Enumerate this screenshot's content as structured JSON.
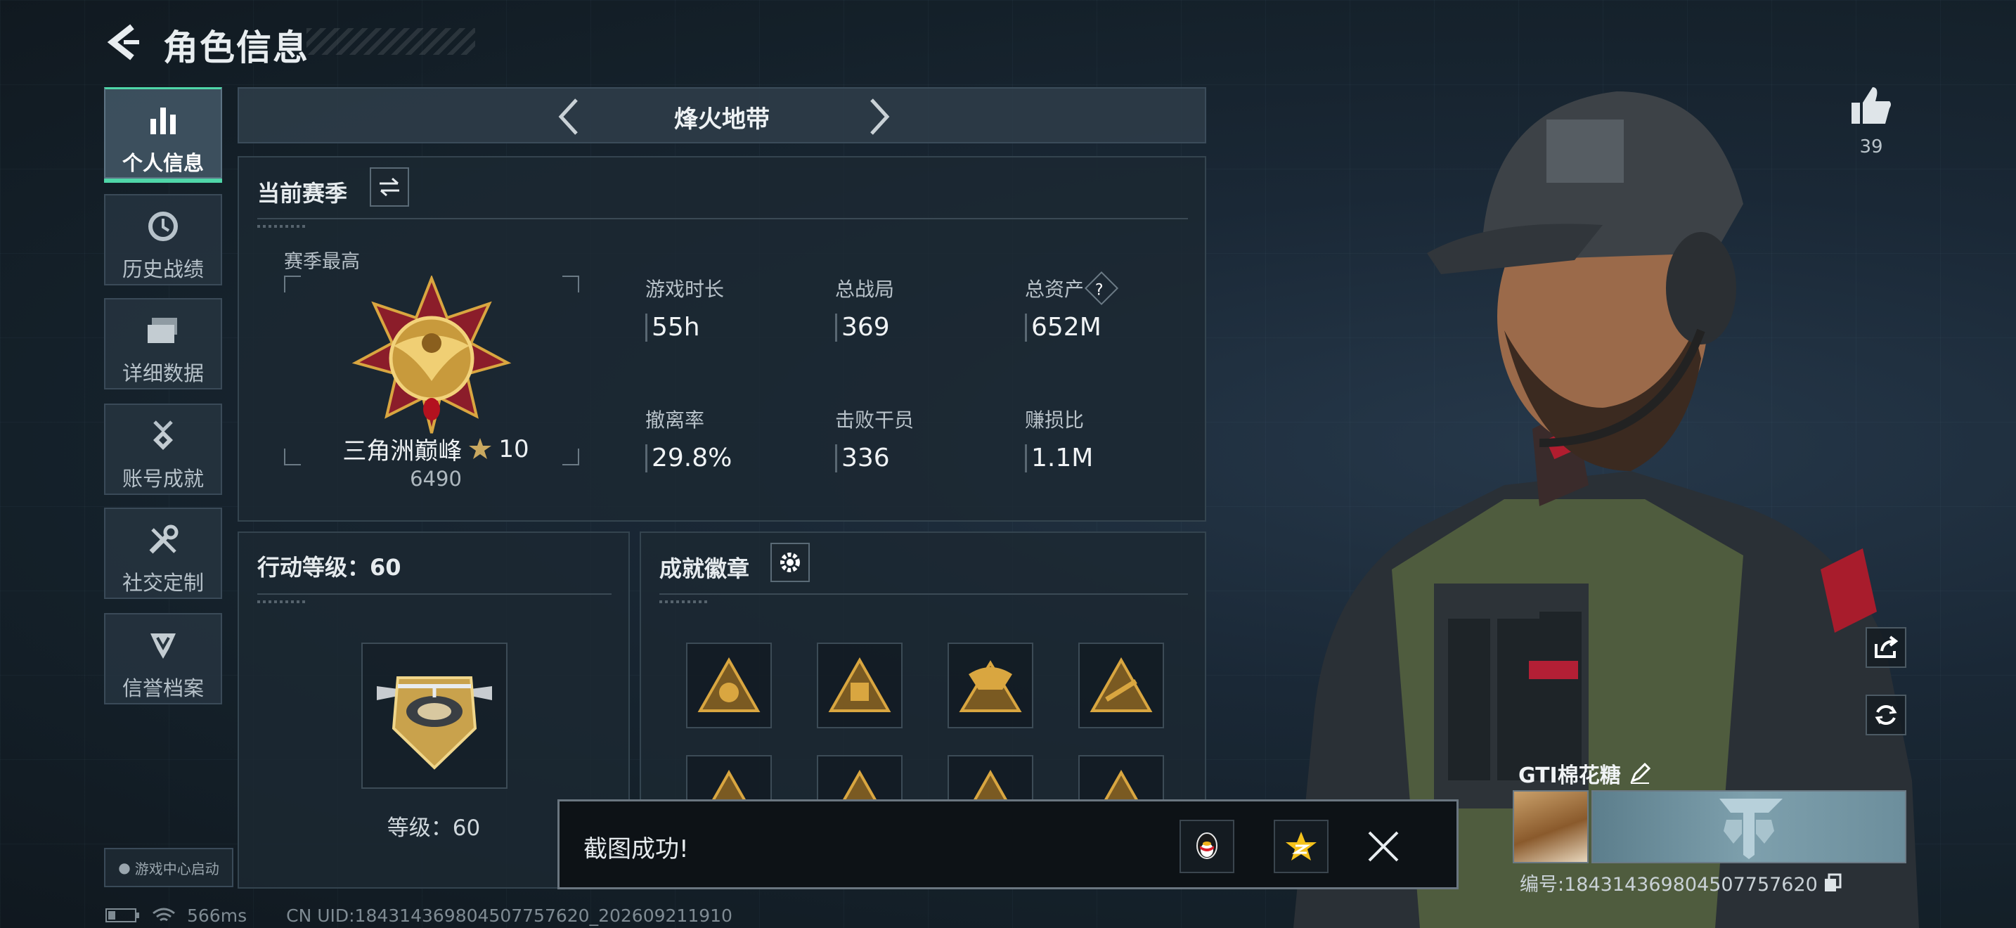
{
  "header": {
    "title": "角色信息"
  },
  "sidebar": {
    "items": [
      {
        "label": "个人信息",
        "icon": "bar-chart-icon",
        "active": true
      },
      {
        "label": "历史战绩",
        "icon": "history-icon",
        "active": false
      },
      {
        "label": "详细数据",
        "icon": "folders-icon",
        "active": false
      },
      {
        "label": "账号成就",
        "icon": "medal-icon",
        "active": false
      },
      {
        "label": "社交定制",
        "icon": "tools-icon",
        "active": false
      },
      {
        "label": "信誉档案",
        "icon": "shield-icon",
        "active": false
      }
    ],
    "game_center": "游戏中心启动"
  },
  "mode": {
    "label": "烽火地带"
  },
  "season": {
    "title": "当前赛季",
    "best_label": "赛季最高",
    "rank_name": "三角洲巅峰",
    "rank_stars": "10",
    "rank_score": "6490",
    "stats": [
      {
        "label": "游戏时长",
        "value": "55h"
      },
      {
        "label": "总战局",
        "value": "369"
      },
      {
        "label": "总资产",
        "value": "652M",
        "help": "?"
      },
      {
        "label": "撤离率",
        "value": "29.8%"
      },
      {
        "label": "击败干员",
        "value": "336"
      },
      {
        "label": "赚损比",
        "value": "1.1M"
      }
    ]
  },
  "action_level": {
    "title": "行动等级：60",
    "level_text": "等级：60"
  },
  "badges": {
    "title": "成就徽章",
    "count": 8
  },
  "toast": {
    "message": "截图成功!"
  },
  "status_bar": {
    "ping": "566ms",
    "uid": "CN UID:18431436980450775762​0_202609211910"
  },
  "profile": {
    "likes": "39",
    "player_name": "GTI棉花糖",
    "uid": "编号:184314369804507757620"
  },
  "colors": {
    "accent": "#4fd6a8",
    "gold": "#d9a640",
    "toast_bg": "#0d1216"
  }
}
